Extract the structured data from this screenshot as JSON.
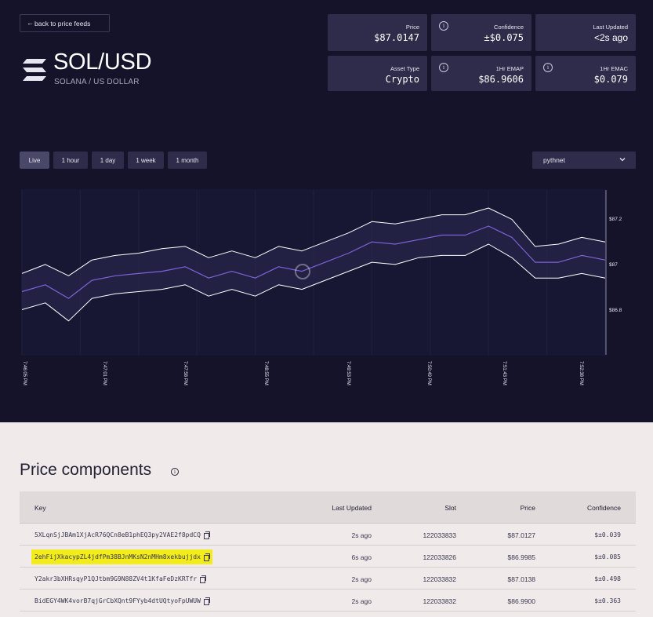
{
  "nav": {
    "back_label": "back to price feeds"
  },
  "header": {
    "symbol": "SOL/USD",
    "name": "SOLANA / US DOLLAR"
  },
  "stats": {
    "price": {
      "label": "Price",
      "value": "$87.0147"
    },
    "confidence": {
      "label": "Confidence",
      "value": "±$0.075"
    },
    "last_updated": {
      "label": "Last Updated",
      "value": "<2s ago"
    },
    "asset_type": {
      "label": "Asset Type",
      "value": "Crypto"
    },
    "emap": {
      "label": "1Hr EMAP",
      "value": "$86.9606"
    },
    "emac": {
      "label": "1Hr EMAC",
      "value": "$0.079"
    }
  },
  "ranges": [
    "Live",
    "1 hour",
    "1 day",
    "1 week",
    "1 month"
  ],
  "active_range": "Live",
  "network": {
    "selected": "pythnet"
  },
  "colors": {
    "background": "#14132a",
    "card": "#2e2c4a",
    "price_line": "#7b63d6",
    "band": "#ffffff",
    "highlight": "#f2ec1c"
  },
  "chart_data": {
    "type": "line",
    "y_ticks": [
      "$87.2",
      "$87",
      "$86.8"
    ],
    "x_ticks": [
      "7:46:05 PM",
      "7:47:01 PM",
      "7:47:58 PM",
      "7:48:55 PM",
      "7:49:53 PM",
      "7:50:49 PM",
      "7:51:43 PM",
      "7:52:38 PM"
    ],
    "ylim": [
      86.62,
      87.35
    ],
    "x": [
      0,
      4,
      8,
      12,
      16,
      20,
      24,
      28,
      32,
      36,
      40,
      44,
      48,
      52,
      56,
      60,
      64,
      68,
      72,
      76,
      80,
      84,
      88,
      92,
      96,
      100
    ],
    "series": [
      {
        "role": "price",
        "values": [
          86.9,
          86.93,
          86.87,
          86.95,
          86.97,
          86.98,
          86.99,
          87.01,
          86.96,
          86.99,
          86.96,
          87.01,
          86.99,
          87.03,
          87.07,
          87.12,
          87.11,
          87.13,
          87.15,
          87.15,
          87.19,
          87.14,
          87.03,
          87.03,
          87.06,
          87.04
        ]
      },
      {
        "role": "upper",
        "values": [
          86.98,
          87.02,
          86.97,
          87.04,
          87.06,
          87.07,
          87.09,
          87.1,
          87.05,
          87.08,
          87.05,
          87.1,
          87.08,
          87.12,
          87.16,
          87.21,
          87.2,
          87.22,
          87.24,
          87.24,
          87.27,
          87.22,
          87.1,
          87.11,
          87.14,
          87.12
        ]
      },
      {
        "role": "lower",
        "values": [
          86.82,
          86.85,
          86.77,
          86.87,
          86.89,
          86.9,
          86.91,
          86.93,
          86.88,
          86.91,
          86.88,
          86.93,
          86.91,
          86.95,
          86.99,
          87.03,
          87.02,
          87.05,
          87.06,
          87.06,
          87.11,
          87.05,
          86.96,
          86.96,
          86.98,
          86.96
        ]
      }
    ]
  },
  "components": {
    "title": "Price components",
    "headers": {
      "key": "Key",
      "last_updated": "Last Updated",
      "slot": "Slot",
      "price": "Price",
      "confidence": "Confidence"
    },
    "rows": [
      {
        "key": "5XLqnSjJBAm1XjAcR76QCn8eB1phEQ3py2VAE2f8pdCQ",
        "last_updated": "2s ago",
        "slot": "122033833",
        "price": "$87.0127",
        "confidence": "$±0.039",
        "highlighted": false
      },
      {
        "key": "2ehFijXkacypZL4jdfPm38BJnMKsN2nMHm8xekbujjdx",
        "last_updated": "6s ago",
        "slot": "122033826",
        "price": "$86.9985",
        "confidence": "$±0.085",
        "highlighted": true
      },
      {
        "key": "Y2akr3bXHRsqyP1QJtbm9G9N88ZV4t1KfaFeDzKRTfr",
        "last_updated": "2s ago",
        "slot": "122033832",
        "price": "$87.0138",
        "confidence": "$±0.498",
        "highlighted": false
      },
      {
        "key": "BidEGY4WK4vorB7qjGrCbXQnt9FYyb4dtUQtyoFpUWUW",
        "last_updated": "2s ago",
        "slot": "122033832",
        "price": "$86.9900",
        "confidence": "$±0.363",
        "highlighted": false
      }
    ]
  }
}
